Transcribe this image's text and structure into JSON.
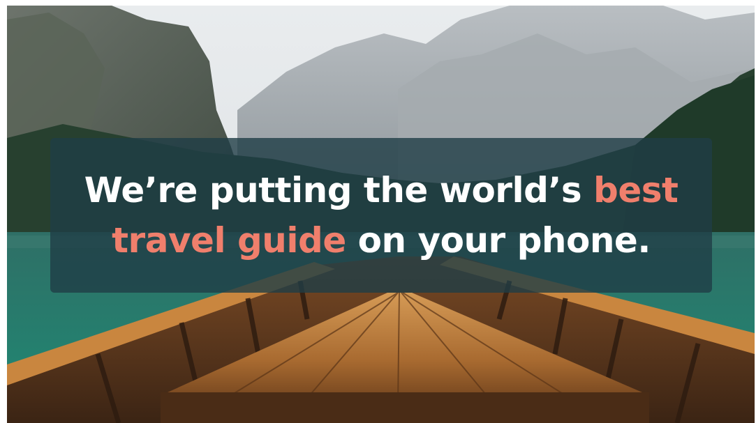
{
  "hero": {
    "line1": {
      "text": "We’re putting the world’s ",
      "highlight": "best"
    },
    "line2": {
      "highlight": "travel guide",
      "text": " on your phone."
    }
  },
  "colors": {
    "highlight": "#f07f6c",
    "overlay": "#1f3d46",
    "text": "#ffffff"
  }
}
